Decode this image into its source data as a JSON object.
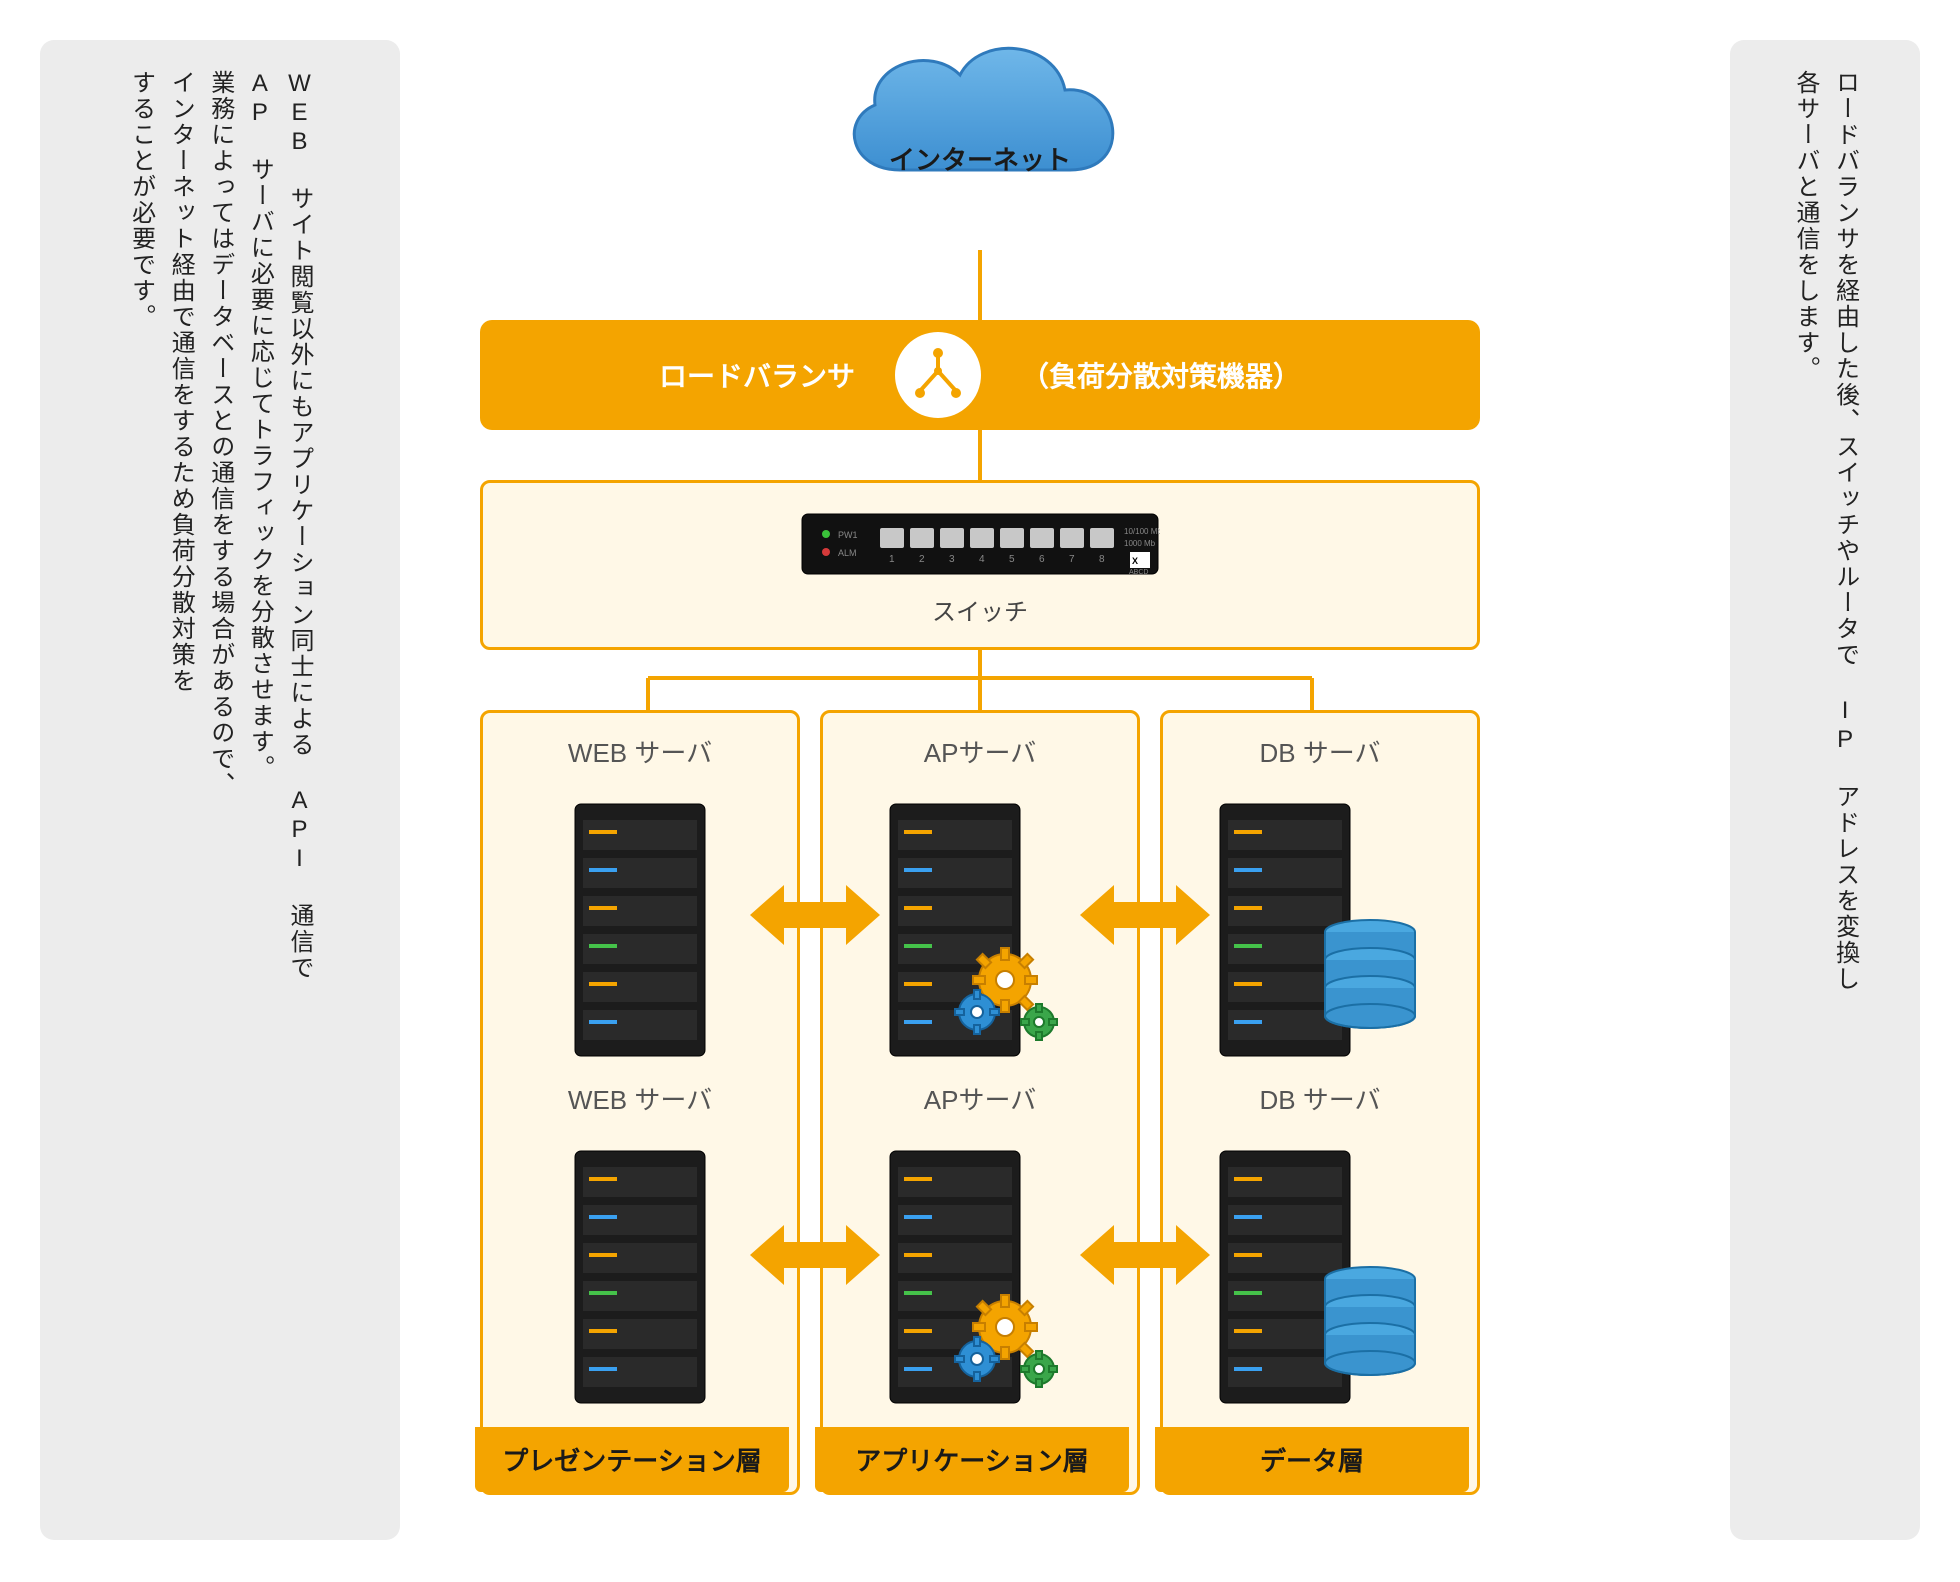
{
  "cloud": {
    "label": "インターネット"
  },
  "load_balancer": {
    "left_label": "ロードバランサ",
    "right_label": "（負荷分散対策機器）"
  },
  "switch": {
    "label": "スイッチ"
  },
  "tiers": {
    "presentation": {
      "server_label": "WEB サーバ",
      "footer": "プレゼンテーション層"
    },
    "application": {
      "server_label": "APサーバ",
      "footer": "アプリケーション層"
    },
    "data": {
      "server_label": "DB サーバ",
      "footer": "データ層"
    }
  },
  "annotations": {
    "right": {
      "line1": "ロードバランサを経由した後、スイッチやルータで IP アドレスを変換し",
      "line2": "各サーバと通信をします。"
    },
    "left": {
      "line1": "WEB サイト閲覧以外にもアプリケーション同士による API 通信で",
      "line2": "AP サーバに必要に応じてトラフィックを分散させます。",
      "line3": "業務によってはデータベースとの通信をする場合があるので、",
      "line4": "インターネット経由で通信をするため負荷分散対策を",
      "line5": "することが必要です。"
    }
  },
  "colors": {
    "accent": "#f4a400",
    "panelbg": "#fff8e7",
    "note": "#ececec"
  }
}
